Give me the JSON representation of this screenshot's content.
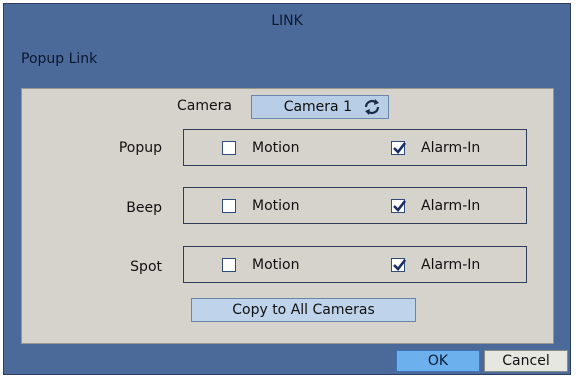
{
  "window": {
    "title": "LINK"
  },
  "section": {
    "title": "Popup Link"
  },
  "camera": {
    "label": "Camera",
    "selected": "Camera 1",
    "icon": "cycle-icon"
  },
  "rows": [
    {
      "label": "Popup",
      "motion_label": "Motion",
      "motion_checked": false,
      "alarm_label": "Alarm-In",
      "alarm_checked": true
    },
    {
      "label": "Beep",
      "motion_label": "Motion",
      "motion_checked": false,
      "alarm_label": "Alarm-In",
      "alarm_checked": true
    },
    {
      "label": "Spot",
      "motion_label": "Motion",
      "motion_checked": false,
      "alarm_label": "Alarm-In",
      "alarm_checked": true
    }
  ],
  "buttons": {
    "copy": "Copy to All Cameras",
    "ok": "OK",
    "cancel": "Cancel"
  },
  "colors": {
    "window_bg": "#4b6a9a",
    "panel_bg": "#d6d3cc",
    "ok_bg": "#6db0ee",
    "select_bg": "#b8cde6"
  }
}
